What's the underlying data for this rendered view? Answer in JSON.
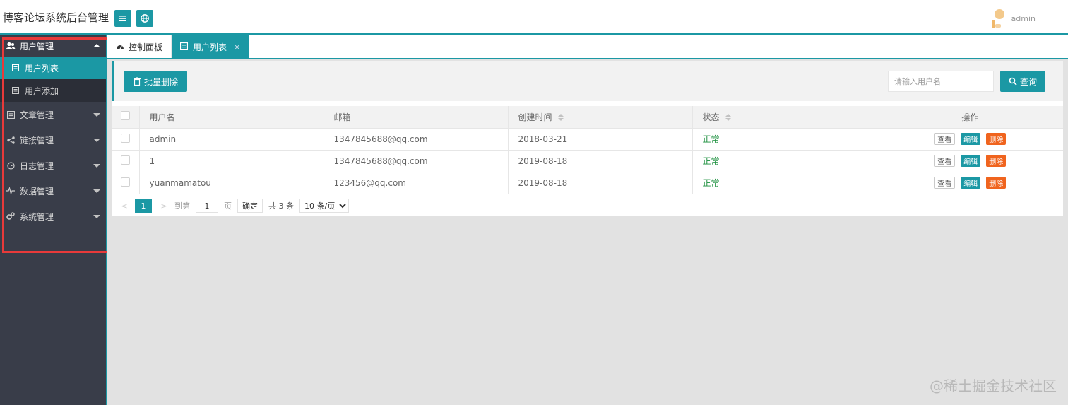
{
  "header": {
    "title": "博客论坛系统后台管理",
    "menu_toggle_icon": "menu-icon",
    "globe_icon": "globe-icon",
    "username": "admin",
    "accent_color": "#1b98a4"
  },
  "sidebar": {
    "groups": [
      {
        "label": "用户管理",
        "icon": "users-icon",
        "open": true,
        "children": [
          {
            "label": "用户列表",
            "active": true
          },
          {
            "label": "用户添加",
            "active": false
          }
        ]
      },
      {
        "label": "文章管理",
        "icon": "document-icon"
      },
      {
        "label": "链接管理",
        "icon": "share-icon"
      },
      {
        "label": "日志管理",
        "icon": "history-icon"
      },
      {
        "label": "数据管理",
        "icon": "pulse-icon"
      },
      {
        "label": "系统管理",
        "icon": "gears-icon"
      }
    ]
  },
  "tabs": [
    {
      "label": "控制面板",
      "icon": "dashboard-icon",
      "active": false
    },
    {
      "label": "用户列表",
      "icon": "document-icon",
      "active": true,
      "close": "×"
    }
  ],
  "toolbar": {
    "batch_delete_label": "批量删除",
    "search_placeholder": "请输入用户名",
    "search_label": "查询"
  },
  "table": {
    "columns": [
      "用户名",
      "邮箱",
      "创建时间",
      "状态",
      "操作"
    ],
    "rows": [
      {
        "username": "admin",
        "email": "1347845688@qq.com",
        "created": "2018-03-21",
        "status": "正常"
      },
      {
        "username": "1",
        "email": "1347845688@qq.com",
        "created": "2019-08-18",
        "status": "正常"
      },
      {
        "username": "yuanmamatou",
        "email": "123456@qq.com",
        "created": "2019-08-18",
        "status": "正常"
      }
    ],
    "actions": {
      "view": "查看",
      "edit": "编辑",
      "delete": "删除"
    }
  },
  "pager": {
    "prev": "<",
    "next": ">",
    "current_page": "1",
    "goto_label": "到第",
    "goto_value": "1",
    "page_unit": "页",
    "confirm_label": "确定",
    "total_label": "共 3 条",
    "page_size": "10 条/页"
  },
  "watermark": "@稀土掘金技术社区"
}
